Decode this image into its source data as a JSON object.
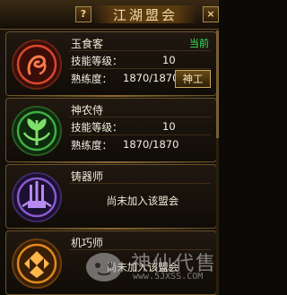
{
  "title": "江湖盟会",
  "help_label": "?",
  "close_label": "×",
  "current_badge": "当前",
  "level_label": "技能等级：",
  "proficiency_label": "熟练度：",
  "not_joined_text": "尚未加入该盟会",
  "skill_button_label": "神工",
  "guilds": [
    {
      "name": "玉食客",
      "level": "10",
      "proficiency": "1870/1870",
      "emblem": "dragon-emblem-icon",
      "accent": "#d9482c"
    },
    {
      "name": "神农侍",
      "level": "10",
      "proficiency": "1870/1870",
      "emblem": "herb-emblem-icon",
      "accent": "#3fae3f"
    },
    {
      "name": "铸器师",
      "emblem": "forge-emblem-icon",
      "accent": "#8a5ad0"
    },
    {
      "name": "机巧师",
      "emblem": "mechanism-emblem-icon",
      "accent": "#e08a1e"
    }
  ],
  "watermark": {
    "text": "神仙代售",
    "url": "www.5JXSS.COM"
  }
}
